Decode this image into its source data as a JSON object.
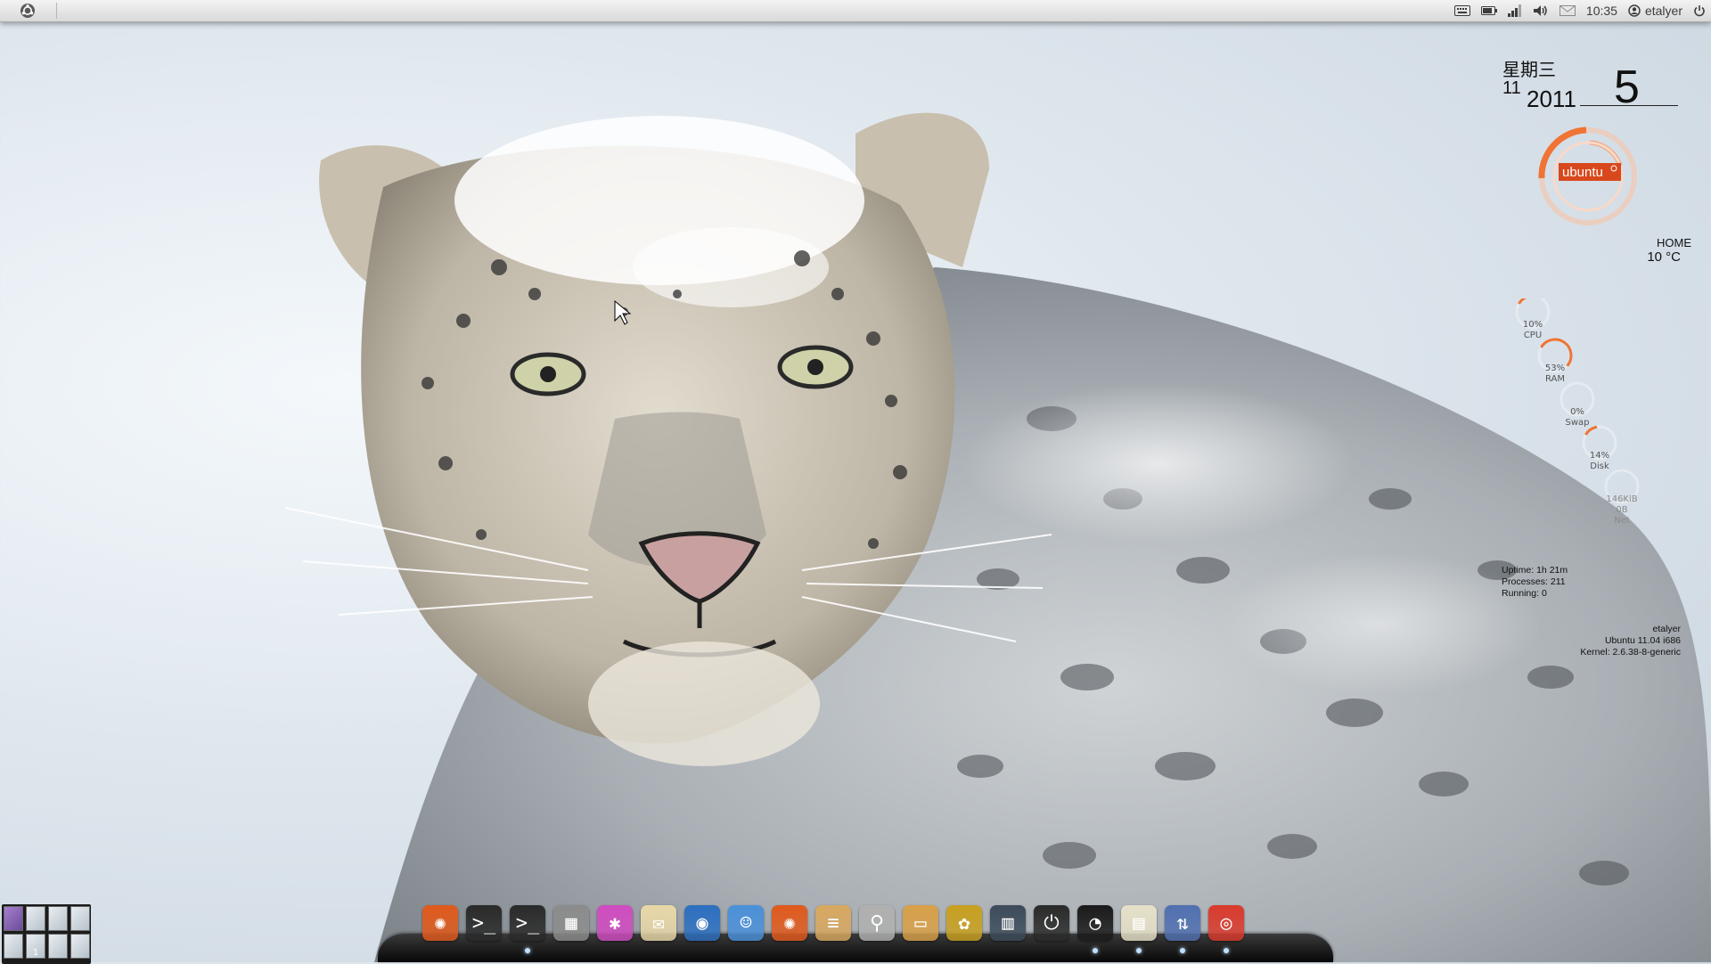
{
  "theme": {
    "accent_orange": "#f07436",
    "panel_bg": "#e3e3e3",
    "dock_bg": "#1a1a1a"
  },
  "top_panel": {
    "menu_icon": "ubuntu-bfb-icon",
    "tray_icons": [
      "keyboard-icon",
      "battery-icon",
      "network-signal-icon",
      "volume-icon",
      "mail-icon"
    ],
    "clock": "10:35",
    "user": "etalyer",
    "user_icon": "user-icon",
    "power_icon": "power-icon"
  },
  "conky": {
    "calendar": {
      "weekday": "星期三",
      "month": "11",
      "year": "2011",
      "day": "5"
    },
    "logo_text": "ubuntu",
    "weather": {
      "location": "HOME",
      "temperature": "10 °C"
    },
    "system": [
      {
        "value": "10%",
        "label": "CPU",
        "fraction": 0.1
      },
      {
        "value": "53%",
        "label": "RAM",
        "fraction": 0.53
      },
      {
        "value": "0%",
        "label": "Swap",
        "fraction": 0.0
      },
      {
        "value": "14%",
        "label": "Disk",
        "fraction": 0.14
      }
    ],
    "network": {
      "up": "146KiB",
      "down": "0B",
      "label": "Net"
    },
    "process_info": {
      "uptime": "Uptime: 1h 21m",
      "processes": "Processes: 211",
      "running": "Running: 0"
    },
    "host_info": {
      "user": "etalyer",
      "os": "Ubuntu 11.04  i686",
      "kernel": "Kernel: 2.6.38-8-generic"
    }
  },
  "workspaces": {
    "count": 8,
    "active_index": 0,
    "current_label": "1"
  },
  "dock": {
    "items": [
      {
        "name": "ubuntu-software-center-icon",
        "color": "#e05a1c",
        "running": false
      },
      {
        "name": "terminal-icon",
        "color": "#2a2a2a",
        "running": false
      },
      {
        "name": "terminal-icon",
        "color": "#2a2a2a",
        "running": true
      },
      {
        "name": "calculator-icon",
        "color": "#8c8c8c",
        "running": false
      },
      {
        "name": "color-picker-icon",
        "color": "#d04cc0",
        "running": false
      },
      {
        "name": "mail-client-icon",
        "color": "#e8d8a8",
        "running": false
      },
      {
        "name": "firefox-icon",
        "color": "#2d6fc0",
        "running": false
      },
      {
        "name": "empathy-chat-icon",
        "color": "#4a90d9",
        "running": false
      },
      {
        "name": "ubuntu-one-icon",
        "color": "#e05a1c",
        "running": false
      },
      {
        "name": "text-editor-icon",
        "color": "#d8a860",
        "running": false
      },
      {
        "name": "search-icon",
        "color": "#b0b0b0",
        "running": false
      },
      {
        "name": "folder-icon",
        "color": "#d8a048",
        "running": false
      },
      {
        "name": "photo-viewer-icon",
        "color": "#c8a020",
        "running": false
      },
      {
        "name": "system-monitor-icon",
        "color": "#3c4a5a",
        "running": false
      },
      {
        "name": "shutdown-icon",
        "color": "#2a2a2a",
        "running": false
      },
      {
        "name": "clock-applet-icon",
        "color": "#1a1a1a",
        "running": true
      },
      {
        "name": "document-viewer-icon",
        "color": "#e6e0c8",
        "running": true
      },
      {
        "name": "transmission-icon",
        "color": "#5070b0",
        "running": true
      },
      {
        "name": "chrome-icon",
        "color": "#d93a2c",
        "running": true
      }
    ]
  }
}
